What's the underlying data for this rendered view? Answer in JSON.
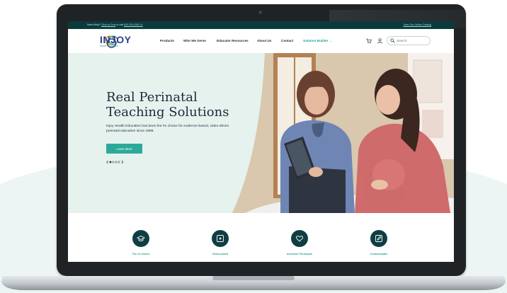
{
  "topbar": {
    "help_prefix": "Need Help?",
    "chat_link": "Click to Chat",
    "call_prefix": "or call",
    "phone": "800.326.2082 x1",
    "catalog_link": "View Our Online Catalog"
  },
  "brand": {
    "name": "INJOY",
    "tagline": "health education"
  },
  "nav": {
    "items": [
      {
        "label": "Products"
      },
      {
        "label": "Who We Serve"
      },
      {
        "label": "Educator Resources"
      },
      {
        "label": "About Us"
      },
      {
        "label": "Contact"
      },
      {
        "label": "Solution Builder →"
      }
    ]
  },
  "search": {
    "placeholder": "Search"
  },
  "hero": {
    "headline": "Real Perinatal Teaching Solutions",
    "subtext": "Injoy Health Education has been the #1 choice for evidence-based, video-driven perinatal education since 1988.",
    "cta": "Learn More",
    "carousel_total": 4,
    "carousel_active": 1
  },
  "features": [
    {
      "label": "The #1 choice",
      "icon": "graduation-cap-icon"
    },
    {
      "label": "Video-based",
      "icon": "play-icon"
    },
    {
      "label": "Inclusive Portrayals",
      "icon": "heart-hands-icon"
    },
    {
      "label": "Customizable",
      "icon": "edit-icon"
    }
  ],
  "colors": {
    "accent": "#2da99a",
    "dark_teal": "#0f3e42",
    "hero_bg": "#eaf4f1",
    "brand_blue": "#2a3f8f"
  }
}
